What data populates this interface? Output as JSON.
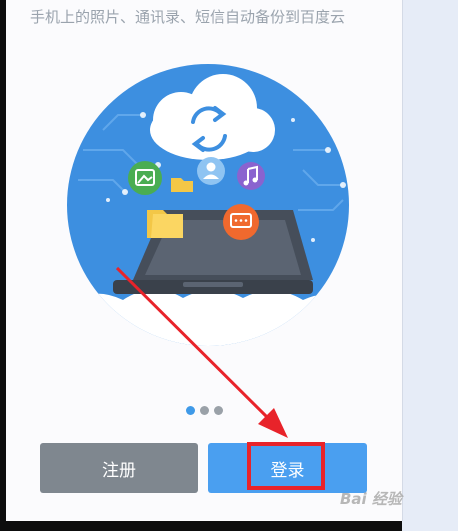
{
  "tagline": "手机上的照片、通讯录、短信自动备份到百度云",
  "pagination": {
    "count": 3,
    "active_index": 0
  },
  "buttons": {
    "register_label": "注册",
    "login_label": "登录"
  },
  "watermark": "Bai 经验",
  "colors": {
    "primary_blue": "#4a9ff0",
    "register_gray": "#7f878f",
    "annotation_red": "#e8232a",
    "circle_blue": "#3d8fe0"
  },
  "icons": [
    "sync-icon",
    "user-icon",
    "image-icon",
    "music-icon",
    "folder-icon",
    "chat-icon",
    "tablet-icon"
  ]
}
